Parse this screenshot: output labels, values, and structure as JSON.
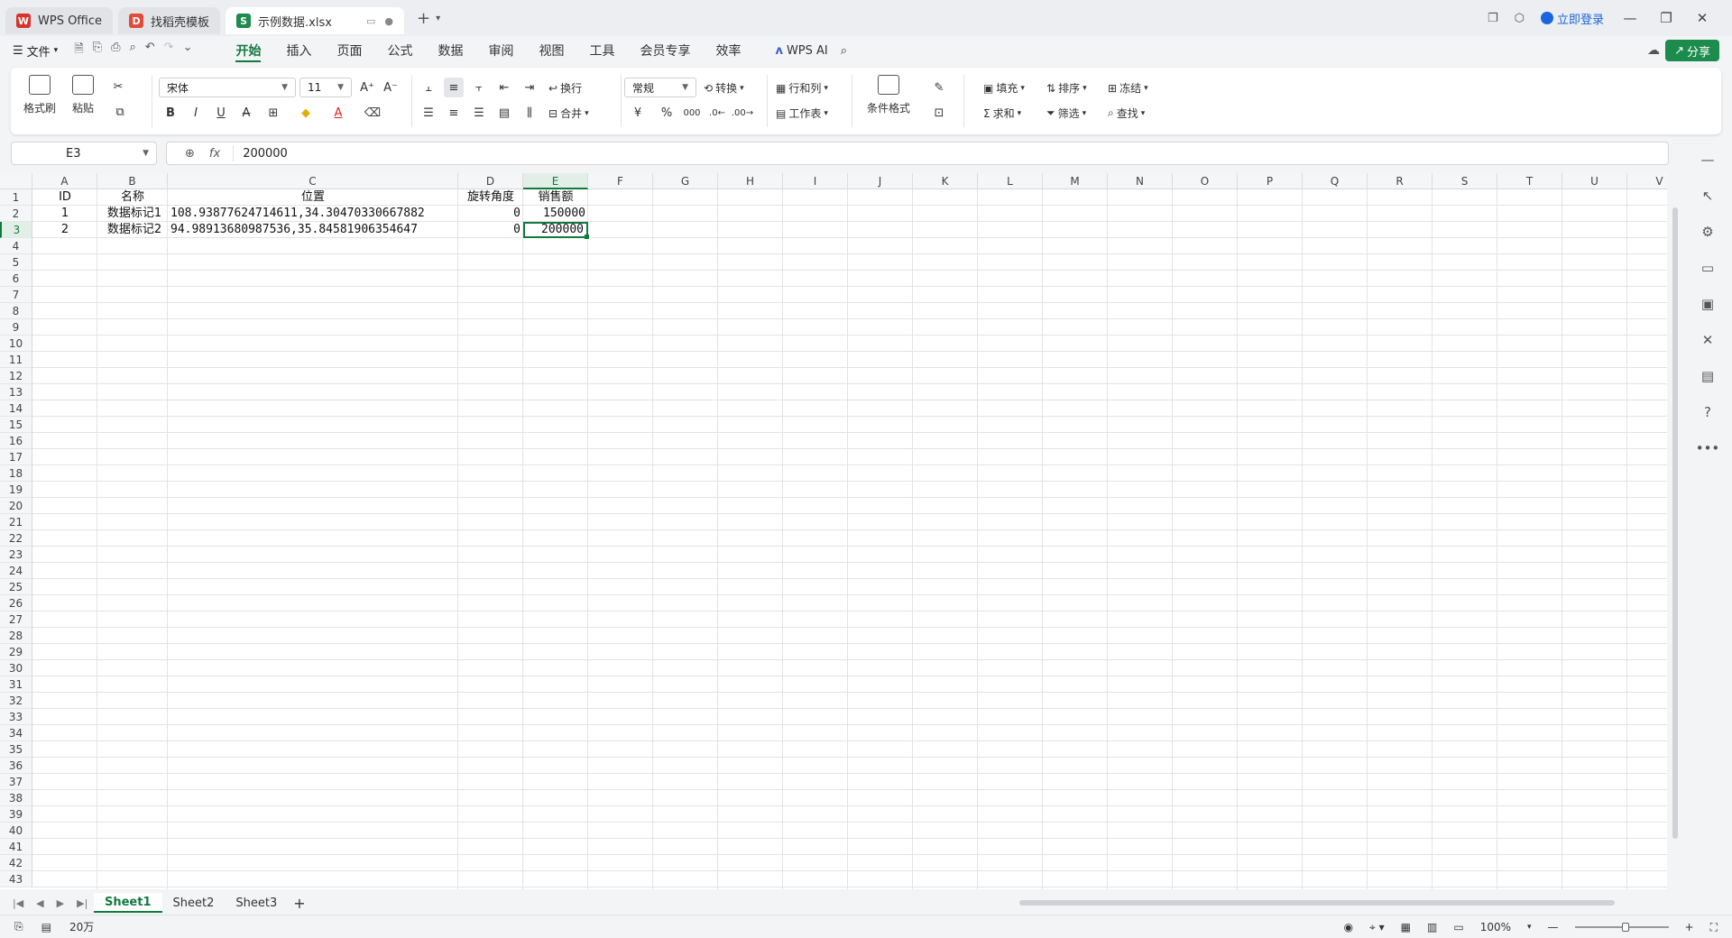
{
  "titlebar": {
    "tabs": [
      {
        "label": "WPS Office",
        "logo": "W",
        "color": "#d7332b"
      },
      {
        "label": "找稻壳模板",
        "logo": "D",
        "color": "#e04b3a"
      },
      {
        "label": "示例数据.xlsx",
        "logo": "S",
        "color": "#1c8c4c"
      }
    ],
    "login": "立即登录"
  },
  "menu": {
    "file": "文件",
    "tabs": [
      "开始",
      "插入",
      "页面",
      "公式",
      "数据",
      "审阅",
      "视图",
      "工具",
      "会员专享",
      "效率"
    ],
    "active_tab": "开始",
    "wps_ai": "WPS AI",
    "share": "分享"
  },
  "ribbon": {
    "format_painter": "格式刷",
    "paste": "粘贴",
    "font_name": "宋体",
    "font_size": "11",
    "wrap": "换行",
    "merge": "合并",
    "number_format": "常规",
    "convert": "转换",
    "rows_cols": "行和列",
    "worksheet": "工作表",
    "conditional_format": "条件格式",
    "fill": "填充",
    "sort": "排序",
    "freeze": "冻结",
    "sum": "求和",
    "filter": "筛选",
    "find": "查找",
    "bold": "B",
    "italic": "I",
    "underline": "U",
    "strike": "A",
    "percent": "%",
    "currency": "¥"
  },
  "formula": {
    "cell_ref": "E3",
    "fx_label": "fx",
    "value": "200000"
  },
  "columns": [
    "A",
    "B",
    "C",
    "D",
    "E",
    "F",
    "G",
    "H",
    "I",
    "J",
    "K",
    "L",
    "M",
    "N",
    "O",
    "P",
    "Q",
    "R",
    "S",
    "T",
    "U",
    "V"
  ],
  "rows": [
    "1",
    "2",
    "3",
    "4",
    "5",
    "6",
    "7",
    "8",
    "9",
    "10",
    "11",
    "12",
    "13",
    "14",
    "15",
    "16",
    "17",
    "18",
    "19",
    "20",
    "21",
    "22",
    "23",
    "24",
    "25",
    "26",
    "27",
    "28",
    "29",
    "30",
    "31",
    "32",
    "33",
    "34",
    "35",
    "36",
    "37",
    "38",
    "39",
    "40",
    "41",
    "42",
    "43"
  ],
  "table": {
    "headers": [
      "ID",
      "名称",
      "位置",
      "旋转角度",
      "销售额"
    ],
    "rows": [
      [
        "1",
        "数据标记1",
        "108.93877624714611,34.30470330667882",
        "0",
        "150000"
      ],
      [
        "2",
        "数据标记2",
        "94.98913680987536,35.84581906354647",
        "0",
        "200000"
      ]
    ]
  },
  "sheets": [
    "Sheet1",
    "Sheet2",
    "Sheet3"
  ],
  "active_sheet": "Sheet1",
  "status": {
    "count": "20万",
    "zoom": "100%"
  },
  "colors": {
    "accent": "#117a3e",
    "share_bg": "#1c8c4c"
  }
}
